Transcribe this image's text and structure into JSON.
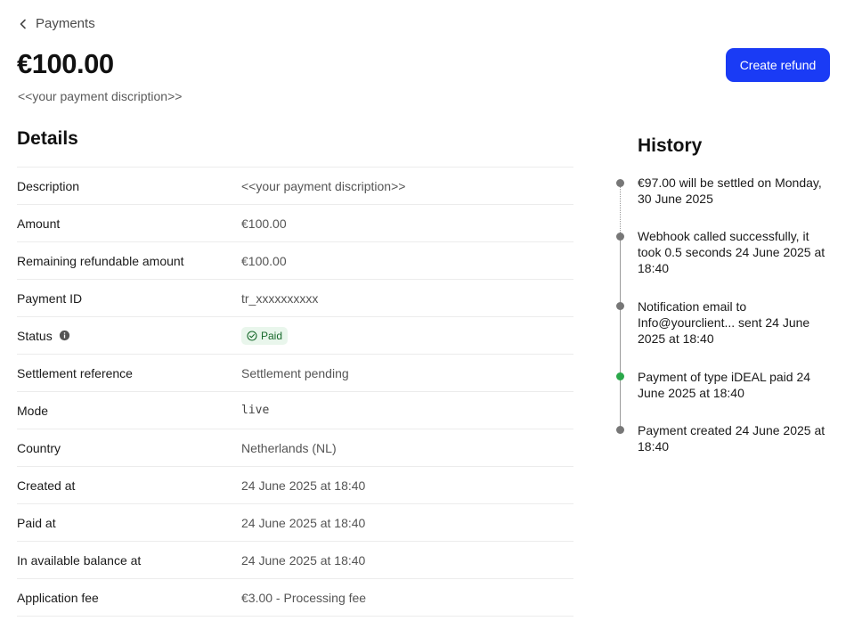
{
  "nav": {
    "back_label": "Payments"
  },
  "header": {
    "amount": "€100.00",
    "description": "<<your payment discription>>",
    "refund_button": "Create refund"
  },
  "details": {
    "title": "Details",
    "rows": [
      {
        "label": "Description",
        "value": "<<your payment discription>>"
      },
      {
        "label": "Amount",
        "value": "€100.00"
      },
      {
        "label": "Remaining refundable amount",
        "value": "€100.00"
      },
      {
        "label": "Payment ID",
        "value": "tr_xxxxxxxxxx"
      },
      {
        "label": "Status",
        "value": "Paid"
      },
      {
        "label": "Settlement reference",
        "value": "Settlement pending"
      },
      {
        "label": "Mode",
        "value": "live"
      },
      {
        "label": "Country",
        "value": "Netherlands (NL)"
      },
      {
        "label": "Created at",
        "value": "24 June 2025 at 18:40"
      },
      {
        "label": "Paid at",
        "value": "24 June 2025 at 18:40"
      },
      {
        "label": "In available balance at",
        "value": "24 June 2025 at 18:40"
      },
      {
        "label": "Application fee",
        "value": "€3.00 - Processing fee"
      }
    ]
  },
  "history": {
    "title": "History",
    "events": [
      {
        "text": "€97.00 will be settled on Monday, 30 June 2025",
        "status": "pending"
      },
      {
        "text": "Webhook called successfully, it took 0.5 seconds 24 June 2025 at 18:40",
        "status": "done"
      },
      {
        "text": "Notification email to Info@yourclient... sent 24 June 2025 at 18:40",
        "status": "done"
      },
      {
        "text": "Payment of type iDEAL paid 24 June 2025 at 18:40",
        "status": "success"
      },
      {
        "text": "Payment created 24 June 2025 at 18:40",
        "status": "done"
      }
    ]
  },
  "colors": {
    "primary_button": "#1a3bf5",
    "paid_badge_bg": "#e9f6ec",
    "paid_badge_text": "#17692b",
    "timeline_success": "#2aa84a",
    "timeline_default": "#777777"
  }
}
